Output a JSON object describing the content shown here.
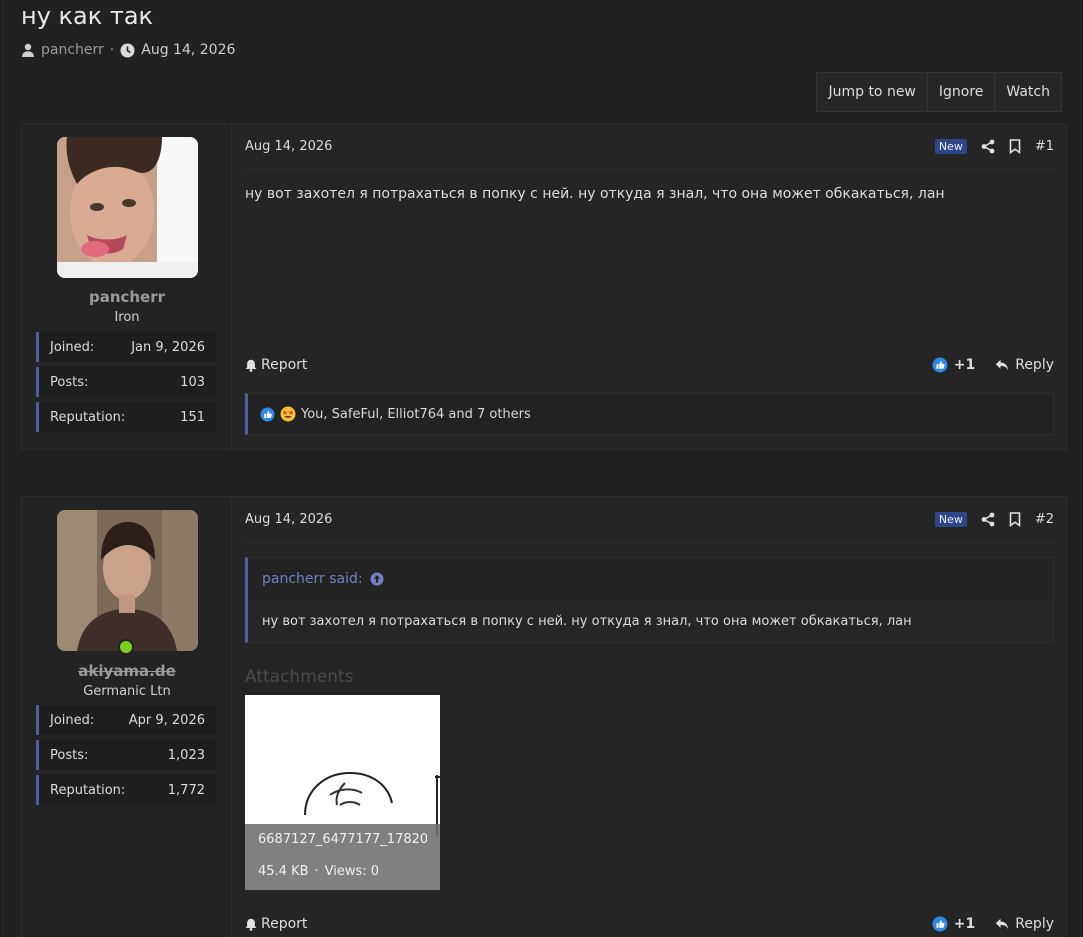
{
  "thread": {
    "title": "ну как так",
    "author": "pancherr",
    "date": "Aug 14, 2026",
    "separator": "·"
  },
  "actions": {
    "jump_to_new": "Jump to new",
    "ignore": "Ignore",
    "watch": "Watch"
  },
  "colors": {
    "accent": "#4b5ea7",
    "online": "#7ccf1a",
    "new_badge": "#2d4786",
    "quote_link": "#7181c2"
  },
  "posts": [
    {
      "date": "Aug 14, 2026",
      "badge": "New",
      "number": "#1",
      "user": {
        "name": "pancherr",
        "title": "Iron",
        "stats": [
          {
            "label": "Joined:",
            "value": "Jan 9, 2026"
          },
          {
            "label": "Posts:",
            "value": "103"
          },
          {
            "label": "Reputation:",
            "value": "151"
          }
        ]
      },
      "body": "ну вот захотел я потрахаться в попку с ней. ну откуда я знал, что она может обкакаться, лан",
      "report": "Report",
      "reaction_count": "+1",
      "reply": "Reply",
      "reactions_text": "You, SafeFul, Elliot764 and 7 others"
    },
    {
      "date": "Aug 14, 2026",
      "badge": "New",
      "number": "#2",
      "user": {
        "name": "akiyama.de",
        "title": "Germanic Ltn",
        "stats": [
          {
            "label": "Joined:",
            "value": "Apr 9, 2026"
          },
          {
            "label": "Posts:",
            "value": "1,023"
          },
          {
            "label": "Reputation:",
            "value": "1,772"
          }
        ]
      },
      "quote": {
        "author": "pancherr said:",
        "text": "ну вот захотел я потрахаться в попку с ней. ну откуда я знал, что она может обкакаться, лан"
      },
      "attachments_label": "Attachments",
      "attachment": {
        "filename": "6687127_6477177_17820...",
        "size": "45.4 KB",
        "separator": "·",
        "views": "Views: 0"
      },
      "report": "Report",
      "reaction_count": "+1",
      "reply": "Reply"
    }
  ]
}
